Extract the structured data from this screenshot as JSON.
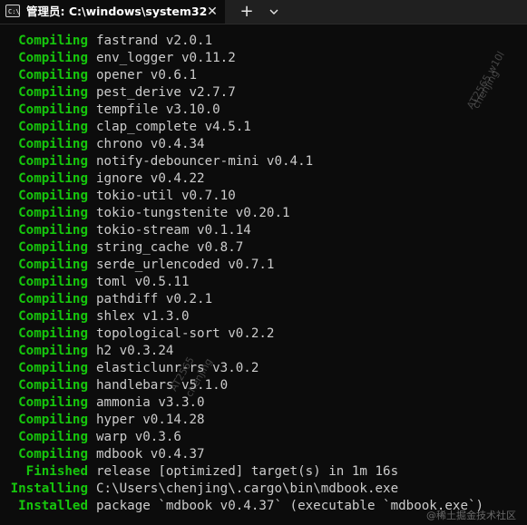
{
  "window": {
    "tab_title": "管理员: C:\\windows\\system32",
    "tab_icon": "terminal-icon",
    "close_symbol": "✕",
    "new_tab_symbol": "+",
    "dropdown_icon": "chevron-down-icon"
  },
  "terminal": {
    "lines": [
      {
        "status": "Compiling",
        "text": "fastrand v2.0.1"
      },
      {
        "status": "Compiling",
        "text": "env_logger v0.11.2"
      },
      {
        "status": "Compiling",
        "text": "opener v0.6.1"
      },
      {
        "status": "Compiling",
        "text": "pest_derive v2.7.7"
      },
      {
        "status": "Compiling",
        "text": "tempfile v3.10.0"
      },
      {
        "status": "Compiling",
        "text": "clap_complete v4.5.1"
      },
      {
        "status": "Compiling",
        "text": "chrono v0.4.34"
      },
      {
        "status": "Compiling",
        "text": "notify-debouncer-mini v0.4.1"
      },
      {
        "status": "Compiling",
        "text": "ignore v0.4.22"
      },
      {
        "status": "Compiling",
        "text": "tokio-util v0.7.10"
      },
      {
        "status": "Compiling",
        "text": "tokio-tungstenite v0.20.1"
      },
      {
        "status": "Compiling",
        "text": "tokio-stream v0.1.14"
      },
      {
        "status": "Compiling",
        "text": "string_cache v0.8.7"
      },
      {
        "status": "Compiling",
        "text": "serde_urlencoded v0.7.1"
      },
      {
        "status": "Compiling",
        "text": "toml v0.5.11"
      },
      {
        "status": "Compiling",
        "text": "pathdiff v0.2.1"
      },
      {
        "status": "Compiling",
        "text": "shlex v1.3.0"
      },
      {
        "status": "Compiling",
        "text": "topological-sort v0.2.2"
      },
      {
        "status": "Compiling",
        "text": "h2 v0.3.24"
      },
      {
        "status": "Compiling",
        "text": "elasticlunr-rs v3.0.2"
      },
      {
        "status": "Compiling",
        "text": "handlebars v5.1.0"
      },
      {
        "status": "Compiling",
        "text": "ammonia v3.3.0"
      },
      {
        "status": "Compiling",
        "text": "hyper v0.14.28"
      },
      {
        "status": "Compiling",
        "text": "warp v0.3.6"
      },
      {
        "status": "Compiling",
        "text": "mdbook v0.4.37"
      },
      {
        "status": "Finished",
        "text": "release [optimized] target(s) in 1m 16s"
      },
      {
        "status": "Installing",
        "text": "C:\\Users\\chenjing\\.cargo\\bin\\mdbook.exe"
      },
      {
        "status": "Installed",
        "text": "package `mdbook v0.4.37` (executable `mdbook.exe`)"
      }
    ]
  },
  "watermarks": {
    "wm1": "AT2565 w10l",
    "wm2": "chenjing",
    "wm3": "AT2565",
    "wm4": "chenjing",
    "footer": "@稀土掘金技术社区"
  },
  "colors": {
    "status_green": "#16c60c",
    "text_gray": "#cccccc",
    "background": "#0c0c0c"
  }
}
